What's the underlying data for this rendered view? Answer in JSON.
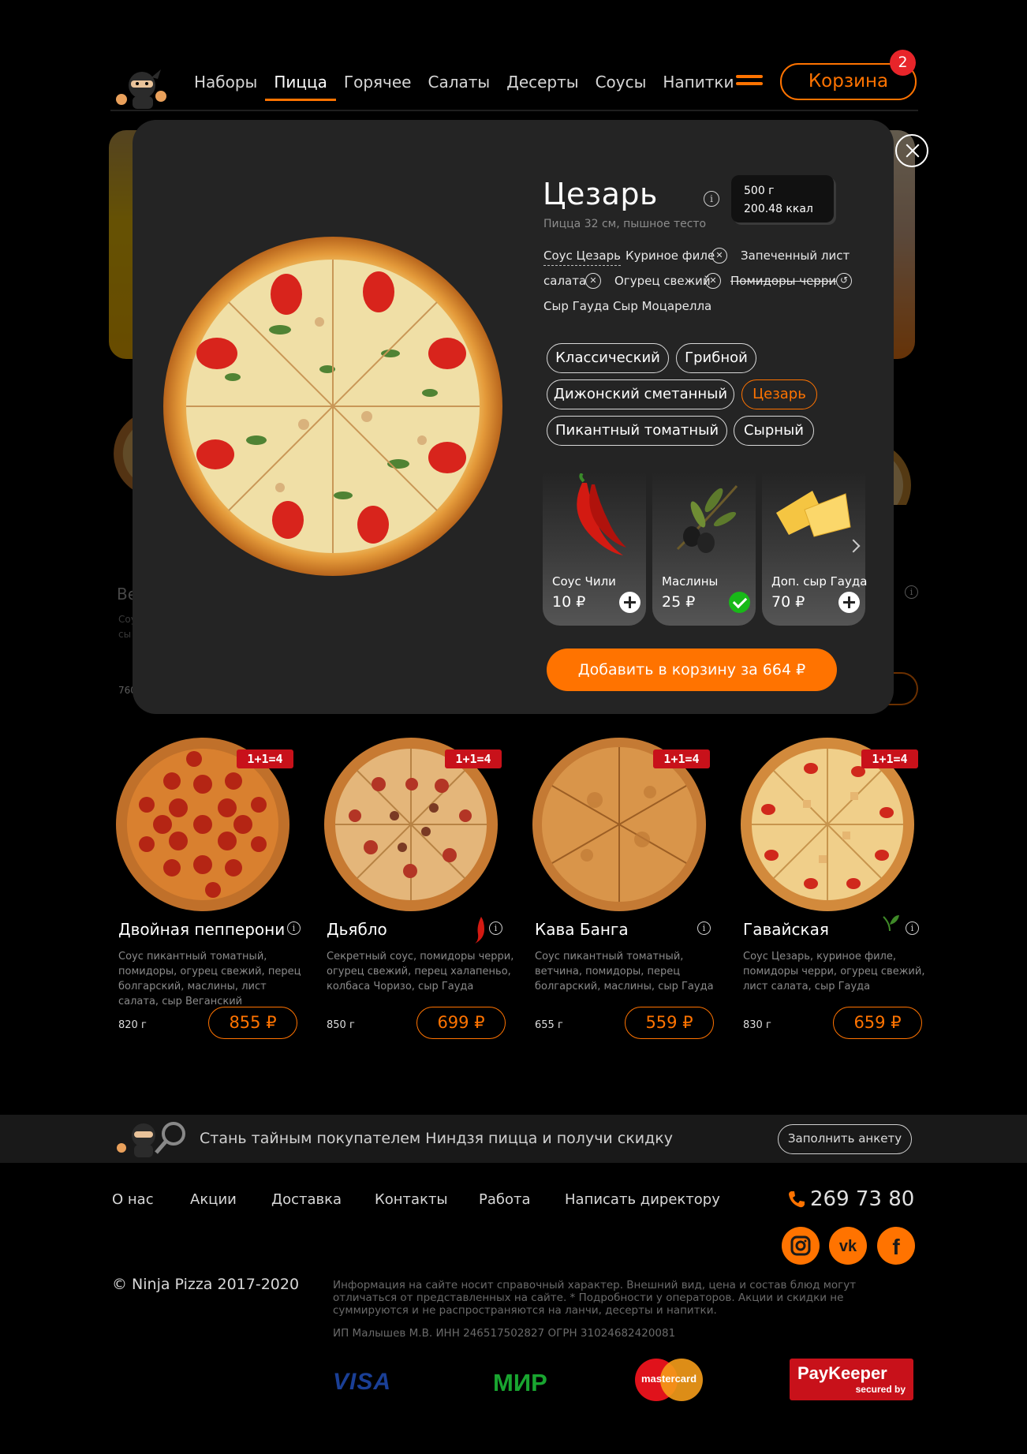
{
  "header": {
    "nav": [
      "Наборы",
      "Пицца",
      "Горячее",
      "Салаты",
      "Десерты",
      "Соусы",
      "Напитки"
    ],
    "active_nav": "Пицца",
    "cart_label": "Корзина",
    "cart_count": "2"
  },
  "background_partial": {
    "left_title": "Ве",
    "left_desc_1": "Соу",
    "left_desc_2": "сы",
    "left_weight": "760"
  },
  "modal": {
    "title": "Цезарь",
    "subtitle": "Пицца 32 см, пышное тесто",
    "info_icon": "i",
    "weight": "500 г",
    "calories": "200.48 ккал",
    "ingredients": [
      {
        "name": "Соус Цезарь",
        "state": "sauce"
      },
      {
        "name": "Куриное филе",
        "state": "removable"
      },
      {
        "name": "Запеченный лист",
        "state": "removable"
      },
      {
        "name": "салата",
        "state": "removable"
      },
      {
        "name": "Огурец свежий",
        "state": "removable"
      },
      {
        "name": "Помидоры черри",
        "state": "removed"
      },
      {
        "name": "Сыр Гауда",
        "state": "fixed"
      },
      {
        "name": "Сыр Моцарелла",
        "state": "fixed"
      }
    ],
    "sauces": [
      "Классический",
      "Грибной",
      "Дижонский сметанный",
      "Цезарь",
      "Пикантный томатный",
      "Сырный"
    ],
    "selected_sauce": "Цезарь",
    "extras": [
      {
        "name": "Соус Чили",
        "price": "10 ₽",
        "added": false
      },
      {
        "name": "Маслины",
        "price": "25 ₽",
        "added": true
      },
      {
        "name": "Доп. сыр Гауда",
        "price": "70 ₽",
        "added": false
      }
    ],
    "add_button": "Добавить в корзину за 664 ₽"
  },
  "products": [
    {
      "promo": "1+1=4",
      "title": "Двойная пепперони",
      "desc": "Соус пикантный томатный, помидоры, огурец свежий, перец болгарский, маслины, лист салата, сыр Веганский",
      "weight": "820 г",
      "price": "855 ₽",
      "badge": ""
    },
    {
      "promo": "1+1=4",
      "title": "Дьябло",
      "desc": "Секретный соус, помидоры черри, огурец свежий, перец халапеньо, колбаса Чоризо, сыр Гауда",
      "weight": "850 г",
      "price": "699 ₽",
      "badge": "chili-icon"
    },
    {
      "promo": "1+1=4",
      "title": "Кава Банга",
      "desc": "Соус пикантный томатный, ветчина, помидоры, перец болгарский, маслины, сыр Гауда",
      "weight": "655 г",
      "price": "559 ₽",
      "badge": ""
    },
    {
      "promo": "1+1=4",
      "title": "Гавайская",
      "desc": "Соус Цезарь, куриное филе, помидоры черри, огурец свежий, лист салата, сыр Гауда",
      "weight": "830 г",
      "price": "659 ₽",
      "badge": "leaf-icon"
    }
  ],
  "mystery": {
    "text": "Стань тайным покупателем Ниндзя пицца и получи скидку",
    "button": "Заполнить анкету"
  },
  "footer": {
    "nav": [
      "О нас",
      "Акции",
      "Доставка",
      "Контакты",
      "Работа",
      "Написать директору"
    ],
    "phone": "269 73 80",
    "copyright": "© Ninja Pizza 2017-2020",
    "legal": "Информация на сайте носит справочный характер. Внешний вид, цена и состав блюд могут отличаться от представленных на сайте. * Подробности у операторов. Акции и скидки не суммируются и не распространяются на ланчи, десерты и напитки.",
    "legal2": "ИП Малышев М.В. ИНН 246517502827 ОГРН 31024682420081",
    "payments": {
      "visa": "VISA",
      "mir": "МИР",
      "mastercard": "mastercard",
      "paykeeper": "PayKeeper",
      "paykeeper_sub": "secured by"
    }
  },
  "colors": {
    "accent": "#ff7300",
    "promo": "#c8111a",
    "modal_bg": "#242424",
    "success": "#18b918"
  }
}
